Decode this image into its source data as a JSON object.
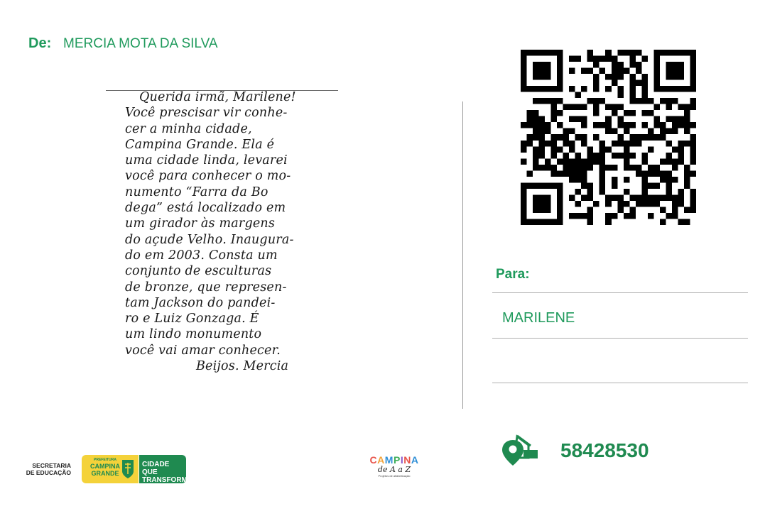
{
  "from": {
    "label": "De:",
    "name": "MERCIA MOTA DA SILVA"
  },
  "letter": {
    "lines": [
      "Querida irmã, Marilene!",
      "Você prescisar vir conhe-",
      "cer a minha cidade,",
      "Campina Grande. Ela é",
      "uma cidade linda, levarei",
      "você para conhecer o mo-",
      "numento “Farra da Bo",
      "dega” está localizado em",
      "um girador às margens",
      "do açude Velho. Inaugura-",
      "do em 2003. Consta um",
      "conjunto de esculturas",
      "de bronze, que represen-",
      "tam Jackson do pandei-",
      "ro e Luiz Gonzaga. É",
      "um lindo monumento",
      "você vai amar conhecer.",
      "Beijos. Mercia"
    ]
  },
  "to": {
    "label": "Para:",
    "name": "MARILENE"
  },
  "cep": {
    "icon": "location-house-icon",
    "value": "58428530"
  },
  "footer": {
    "secretaria": "SECRETARIA DE EDUCAÇÃO",
    "prefeitura_small": "PREFEITURA",
    "prefeitura_name": "CAMPINA GRANDE",
    "slogan": "CIDADE QUE TRANSFORMA",
    "project_title": "CAMPINA",
    "project_sub": "de A a Z",
    "project_tagline": "Projetos de alfabetização"
  },
  "colors": {
    "brand_green": "#1f9a5c",
    "dark_green": "#1f8a50",
    "yellow": "#f4d23a"
  }
}
